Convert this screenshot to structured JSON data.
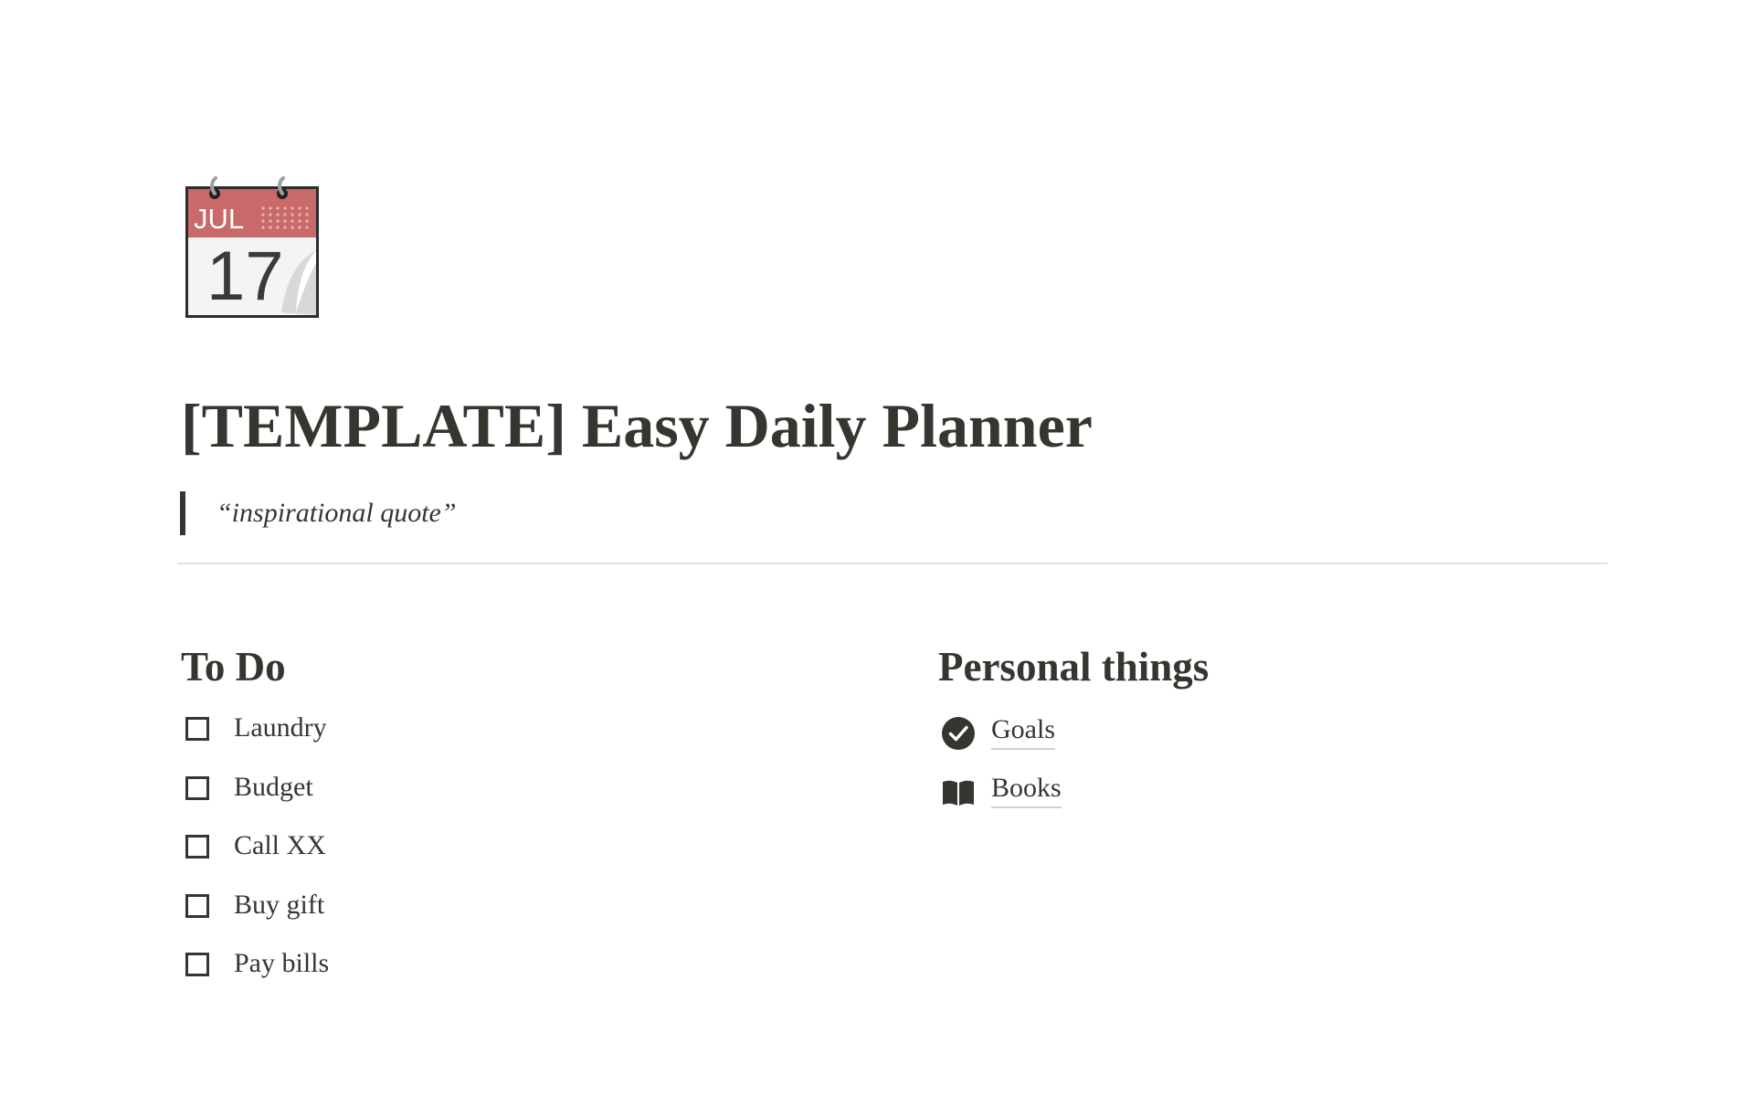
{
  "page": {
    "icon": "calendar-icon",
    "icon_month": "JUL",
    "icon_day": "17",
    "title": "[TEMPLATE] Easy Daily Planner",
    "quote": "“inspirational quote”"
  },
  "todo": {
    "heading": "To Do",
    "items": [
      {
        "label": "Laundry",
        "checked": false
      },
      {
        "label": "Budget",
        "checked": false
      },
      {
        "label": "Call XX",
        "checked": false
      },
      {
        "label": "Buy gift",
        "checked": false
      },
      {
        "label": "Pay bills",
        "checked": false
      }
    ]
  },
  "personal": {
    "heading": "Personal things",
    "links": [
      {
        "label": "Goals",
        "icon": "check-circle-icon"
      },
      {
        "label": "Books",
        "icon": "open-book-icon"
      }
    ]
  },
  "colors": {
    "text": "#37352f",
    "divider": "#e3e2e0",
    "calendar_header": "#c96a6a",
    "link_underline": "#d3d1cb"
  }
}
